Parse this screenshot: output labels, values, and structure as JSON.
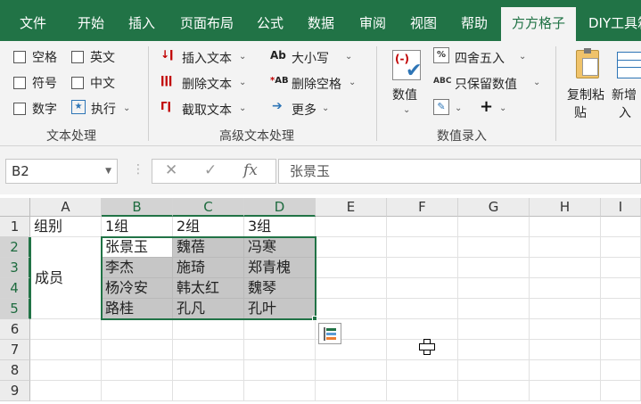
{
  "ribbon_tabs": [
    "文件",
    "开始",
    "插入",
    "页面布局",
    "公式",
    "数据",
    "审阅",
    "视图",
    "帮助",
    "方方格子",
    "DIY工具箱"
  ],
  "active_tab": "方方格子",
  "text_group": {
    "label": "文本处理",
    "checkboxes": [
      "空格",
      "英文",
      "符号",
      "中文",
      "数字"
    ],
    "execute": "执行"
  },
  "adv_group": {
    "label": "高级文本处理",
    "insert_text": "插入文本",
    "delete_text": "删除文本",
    "extract_text": "截取文本",
    "case": "大小写",
    "delete_space": "删除空格",
    "more": "更多"
  },
  "num_group": {
    "label": "数值录入",
    "value": "数值",
    "round": "四舍五入",
    "keep_value": "只保留数值"
  },
  "paste_group": {
    "copy_paste_1": "复制粘",
    "copy_paste_2": "贴",
    "add_insert_1": "新增",
    "add_insert_2": "入"
  },
  "name_box": "B2",
  "formula_value": "张景玉",
  "columns": [
    "A",
    "B",
    "C",
    "D",
    "E",
    "F",
    "G",
    "H",
    "I"
  ],
  "rows": [
    "1",
    "2",
    "3",
    "4",
    "5",
    "6",
    "7",
    "8",
    "9"
  ],
  "cells": {
    "A1": "组别",
    "B1": "1组",
    "C1": "2组",
    "D1": "3组",
    "A3": "成员",
    "B2": "张景玉",
    "C2": "魏蓓",
    "D2": "冯寒",
    "B3": "李杰",
    "C3": "施琦",
    "D3": "郑青槐",
    "B4": "杨冷安",
    "C4": "韩太红",
    "D4": "魏琴",
    "B5": "路桂",
    "C5": "孔凡",
    "D5": "孔叶"
  },
  "icons": {
    "insert_text": "insert-text-icon",
    "delete_text": "delete-text-icon",
    "extract_text": "extract-text-icon",
    "case": "case-icon",
    "delete_space": "delete-space-icon",
    "more": "arrow-right-icon",
    "value": "value-check-icon",
    "round": "round-icon",
    "keep_value": "keep-value-icon",
    "paste": "clipboard-icon",
    "quick_analysis": "quick-analysis-icon"
  },
  "accent": "#217346"
}
